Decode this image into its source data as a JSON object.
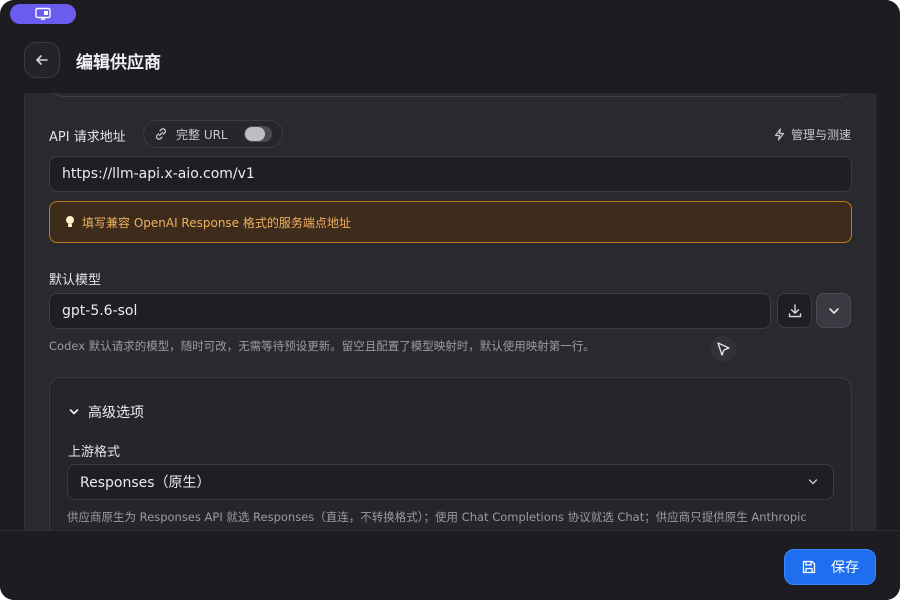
{
  "header": {
    "title": "编辑供应商",
    "back_icon": "arrow-left-icon",
    "top_pill_icon": "monitor-icon"
  },
  "api_url": {
    "label": "API 请求地址",
    "toggle_label": "完整 URL",
    "toggle_on": false,
    "manage_label": "管理与测速",
    "value": "https://llm-api.x-aio.com/v1",
    "notice": "填写兼容 OpenAI Response 格式的服务端点地址"
  },
  "default_model": {
    "label": "默认模型",
    "value": "gpt-5.6-sol",
    "hint": "Codex 默认请求的模型，随时可改，无需等待预设更新。留空且配置了模型映射时，默认使用映射第一行。"
  },
  "advanced": {
    "title": "高级选项",
    "upstream_label": "上游格式",
    "upstream_value": "Responses（原生）",
    "upstream_hint": "供应商原生为 Responses API 就选 Responses（直连，不转换格式）；使用 Chat Completions 协议就选 Chat；供应商只提供原生 Anthropic"
  },
  "footer": {
    "save_label": "保存"
  },
  "colors": {
    "accent": "#1f6ef0",
    "notice_border": "#c6781f",
    "notice_text": "#f0b060",
    "pill": "#6b5cf0"
  }
}
